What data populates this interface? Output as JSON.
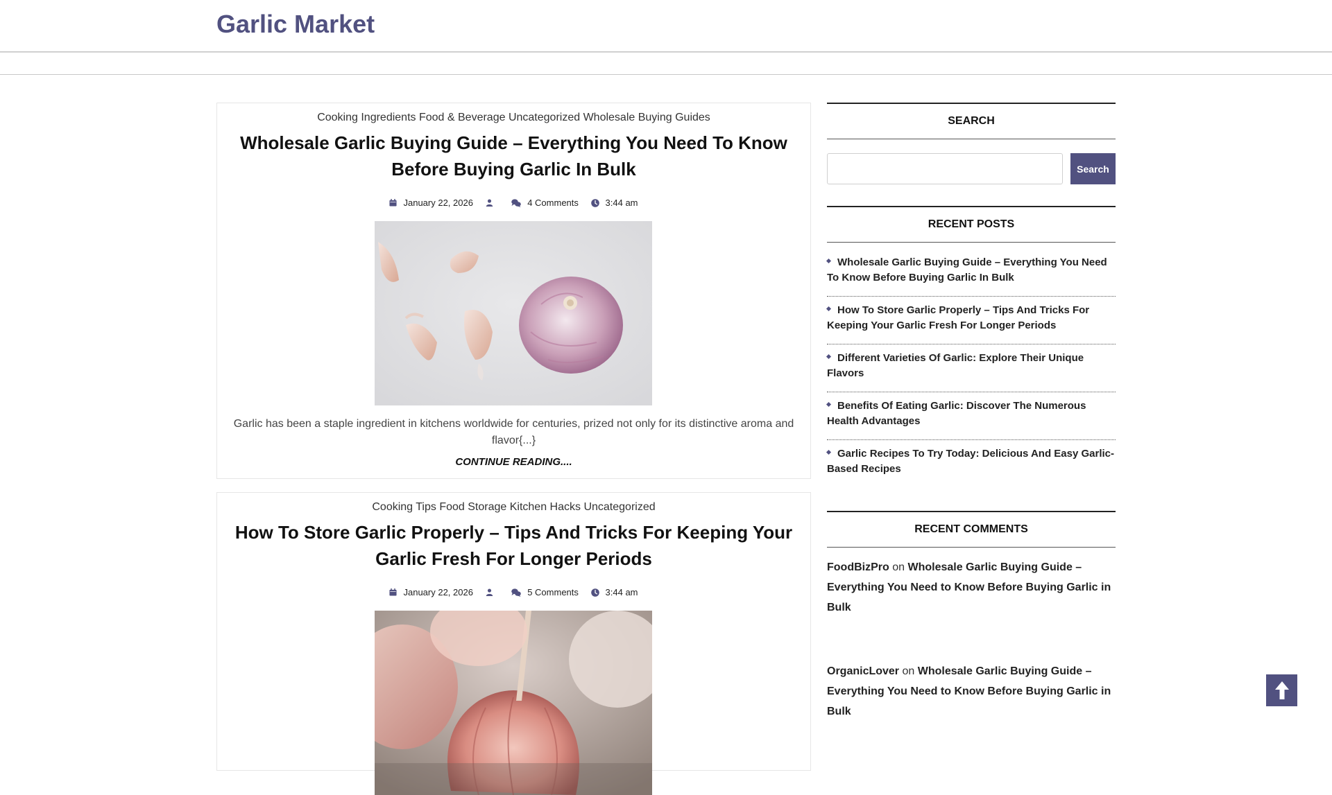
{
  "site": {
    "title": "Garlic Market"
  },
  "posts": [
    {
      "categories": [
        "Cooking Ingredients",
        "Food & Beverage",
        "Uncategorized",
        "Wholesale Buying Guides"
      ],
      "title": "Wholesale Garlic Buying Guide – Everything You Need To Know Before Buying Garlic In Bulk",
      "date": "January 22, 2026",
      "comments": "4 Comments",
      "time": "3:44 am",
      "excerpt": "Garlic has been a staple ingredient in kitchens worldwide for centuries, prized not only for its distinctive aroma and flavor{...}",
      "read_more": "CONTINUE READING...."
    },
    {
      "categories": [
        "Cooking Tips",
        "Food Storage",
        "Kitchen Hacks",
        "Uncategorized"
      ],
      "title": "How To Store Garlic Properly – Tips And Tricks For Keeping Your Garlic Fresh For Longer Periods",
      "date": "January 22, 2026",
      "comments": "5 Comments",
      "time": "3:44 am"
    }
  ],
  "sidebar": {
    "search": {
      "title": "SEARCH",
      "button": "Search"
    },
    "recent_posts": {
      "title": "RECENT POSTS",
      "items": [
        "Wholesale Garlic Buying Guide – Everything You Need To Know Before Buying Garlic In Bulk",
        "How To Store Garlic Properly – Tips And Tricks For Keeping Your Garlic Fresh For Longer Periods",
        "Different Varieties Of Garlic: Explore Their Unique Flavors",
        "Benefits Of Eating Garlic: Discover The Numerous Health Advantages",
        "Garlic Recipes To Try Today: Delicious And Easy Garlic-Based Recipes"
      ]
    },
    "recent_comments": {
      "title": "RECENT COMMENTS",
      "items": [
        {
          "author": "FoodBizPro",
          "on": "on",
          "post": "Wholesale Garlic Buying Guide – Everything You Need to Know Before Buying Garlic in Bulk"
        },
        {
          "author": "OrganicLover",
          "on": "on",
          "post": "Wholesale Garlic Buying Guide – Everything You Need to Know Before Buying Garlic in Bulk"
        }
      ]
    }
  },
  "icons": [
    "calendar-icon",
    "user-icon",
    "comments-icon",
    "clock-icon",
    "arrow-up-icon"
  ],
  "colors": {
    "accent": "#515180",
    "text": "#222222"
  }
}
